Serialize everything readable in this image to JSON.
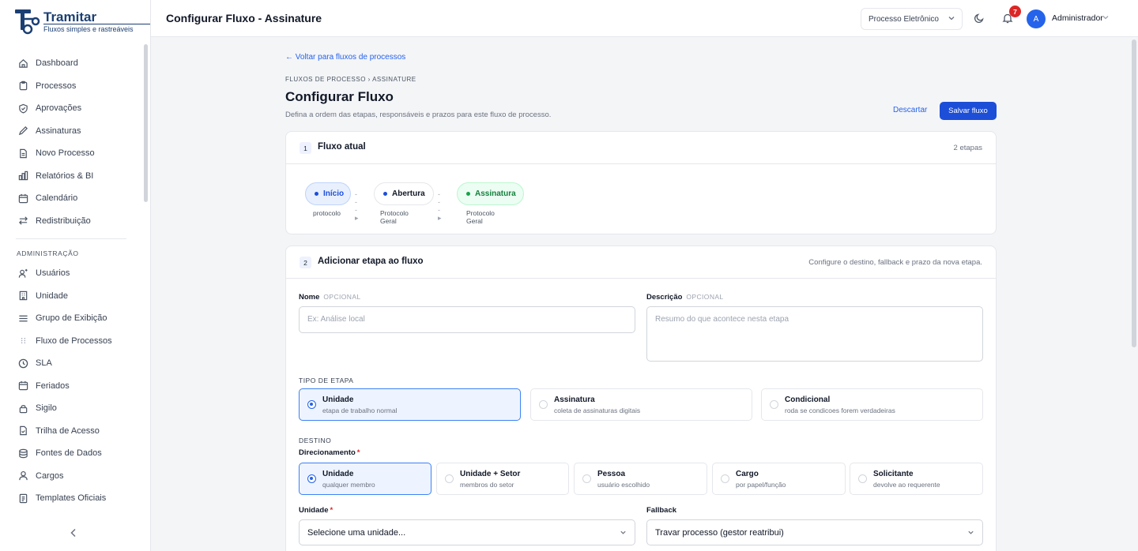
{
  "brand": {
    "name": "Tramitar",
    "tagline": "Fluxos simples e rastreáveis"
  },
  "sidebar": {
    "items": [
      {
        "label": "Dashboard",
        "icon": "home-icon"
      },
      {
        "label": "Processos",
        "icon": "clipboard-icon"
      },
      {
        "label": "Aprovações",
        "icon": "shield-check-icon"
      },
      {
        "label": "Assinaturas",
        "icon": "pen-icon"
      },
      {
        "label": "Novo Processo",
        "icon": "file-icon"
      },
      {
        "label": "Relatórios & BI",
        "icon": "bar-chart-icon"
      },
      {
        "label": "Calendário",
        "icon": "calendar-icon"
      },
      {
        "label": "Redistribuição",
        "icon": "swap-arrows-icon"
      }
    ],
    "admin_section": "ADMINISTRAÇÃO",
    "admin_items": [
      {
        "label": "Usuários",
        "icon": "users-icon"
      },
      {
        "label": "Unidade",
        "icon": "building-icon"
      },
      {
        "label": "Grupo de Exibição",
        "icon": "menu-lines-icon"
      },
      {
        "label": "Fluxo de Processos",
        "icon": "drag-grid-icon"
      },
      {
        "label": "SLA",
        "icon": "clock-icon"
      },
      {
        "label": "Feriados",
        "icon": "calendar-icon"
      },
      {
        "label": "Sigilo",
        "icon": "lock-icon"
      },
      {
        "label": "Trilha de Acesso",
        "icon": "file-check-icon"
      },
      {
        "label": "Fontes de Dados",
        "icon": "database-icon"
      },
      {
        "label": "Cargos",
        "icon": "user-icon"
      },
      {
        "label": "Templates Oficiais",
        "icon": "template-icon"
      }
    ]
  },
  "header": {
    "title": "Configurar Fluxo - Assinature",
    "process_select": "Processo Eletrônico",
    "notifications": "7",
    "avatar_initial": "A",
    "user_name": "Administrador"
  },
  "page": {
    "back_link": "Voltar para fluxos de processos",
    "breadcrumb": "FLUXOS DE PROCESSO › ASSINATURE",
    "title": "Configurar Fluxo",
    "subtitle": "Defina a ordem das etapas, responsáveis e prazos para este fluxo de processo.",
    "discard": "Descartar",
    "save": "Salvar fluxo"
  },
  "current_flow": {
    "number": "1",
    "title": "Fluxo atual",
    "count": "2 etapas",
    "steps": [
      {
        "label": "Início",
        "sub": "protocolo"
      },
      {
        "label": "Abertura",
        "sub": "Protocolo Geral"
      },
      {
        "label": "Assinatura",
        "sub": "Protocolo Geral"
      }
    ]
  },
  "add_step": {
    "number": "2",
    "title": "Adicionar etapa ao fluxo",
    "hint": "Configure o destino, fallback e prazo da nova etapa.",
    "name_label": "Nome",
    "optional": "OPCIONAL",
    "name_placeholder": "Ex: Análise local",
    "desc_label": "Descrição",
    "desc_placeholder": "Resumo do que acontece nesta etapa",
    "type_caption": "TIPO DE ETAPA",
    "types": [
      {
        "title": "Unidade",
        "sub": "etapa de trabalho normal"
      },
      {
        "title": "Assinatura",
        "sub": "coleta de assinaturas digitais"
      },
      {
        "title": "Condicional",
        "sub": "roda se condicoes forem verdadeiras"
      }
    ],
    "dest_caption": "DESTINO",
    "direction_label": "Direcionamento",
    "required_mark": "*",
    "directions": [
      {
        "title": "Unidade",
        "sub": "qualquer membro"
      },
      {
        "title": "Unidade + Setor",
        "sub": "membros do setor"
      },
      {
        "title": "Pessoa",
        "sub": "usuário escolhido"
      },
      {
        "title": "Cargo",
        "sub": "por papel/função"
      },
      {
        "title": "Solicitante",
        "sub": "devolve ao requerente"
      }
    ],
    "unit_label": "Unidade",
    "unit_value": "Selecione uma unidade...",
    "fallback_label": "Fallback",
    "fallback_value": "Travar processo (gestor reatribui)"
  }
}
